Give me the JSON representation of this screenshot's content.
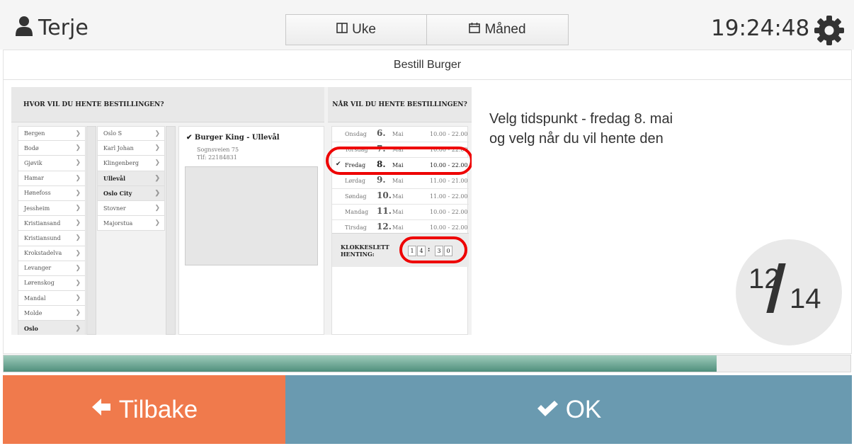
{
  "header": {
    "user_name": "Terje",
    "view_week": "Uke",
    "view_month": "Måned",
    "clock": "19:24:48"
  },
  "content": {
    "subtitle": "Bestill Burger",
    "instruction_line1": "Velg tidspunkt - fredag 8. mai",
    "instruction_line2": "og velg når du vil hente den",
    "step_current": "12",
    "step_total": "14"
  },
  "embedded_screenshot": {
    "where_heading": "HVOR VIL DU HENTE BESTILLINGEN?",
    "when_heading": "NÅR VIL DU HENTE BESTILLINGEN?",
    "cities": [
      "Bergen",
      "Bodø",
      "Gjøvik",
      "Hamar",
      "Hønefoss",
      "Jessheim",
      "Kristiansand",
      "Kristiansund",
      "Krokstadelva",
      "Levanger",
      "Lørenskog",
      "Mandal",
      "Molde",
      "Oslo"
    ],
    "districts": [
      "Oslo S",
      "Karl Johan",
      "Klingenberg",
      "Ullevål",
      "Oslo City",
      "Stovner",
      "Majorstua"
    ],
    "store_name": "Burger King - Ullevål",
    "store_address": "Sognsveien 75",
    "store_phone": "Tlf: 22184831",
    "days": [
      {
        "name": "Onsdag",
        "num": "6.",
        "month": "Mai",
        "hours": "10.00 - 22.00"
      },
      {
        "name": "Torsdag",
        "num": "7.",
        "month": "Mai",
        "hours": "10.00 - 22.00"
      },
      {
        "name": "Fredag",
        "num": "8.",
        "month": "Mai",
        "hours": "10.00 - 22.00"
      },
      {
        "name": "Lørdag",
        "num": "9.",
        "month": "Mai",
        "hours": "11.00 - 21.00"
      },
      {
        "name": "Søndag",
        "num": "10.",
        "month": "Mai",
        "hours": "11.00 - 22.00"
      },
      {
        "name": "Mandag",
        "num": "11.",
        "month": "Mai",
        "hours": "10.00 - 22.00"
      },
      {
        "name": "Tirsdag",
        "num": "12.",
        "month": "Mai",
        "hours": "10.00 - 22.00"
      }
    ],
    "time_label_line1": "KLOKKESLETT",
    "time_label_line2": "HENTING:",
    "time_digits": [
      "1",
      "4",
      "3",
      "0"
    ],
    "time_separator": ":"
  },
  "progress": {
    "fraction": 0.842
  },
  "buttons": {
    "back_label": "Tilbake",
    "ok_label": "OK"
  },
  "colors": {
    "back": "#f07a4c",
    "ok": "#6a9ab0",
    "progress": "#5f9c89",
    "annotation": "#e00000"
  }
}
